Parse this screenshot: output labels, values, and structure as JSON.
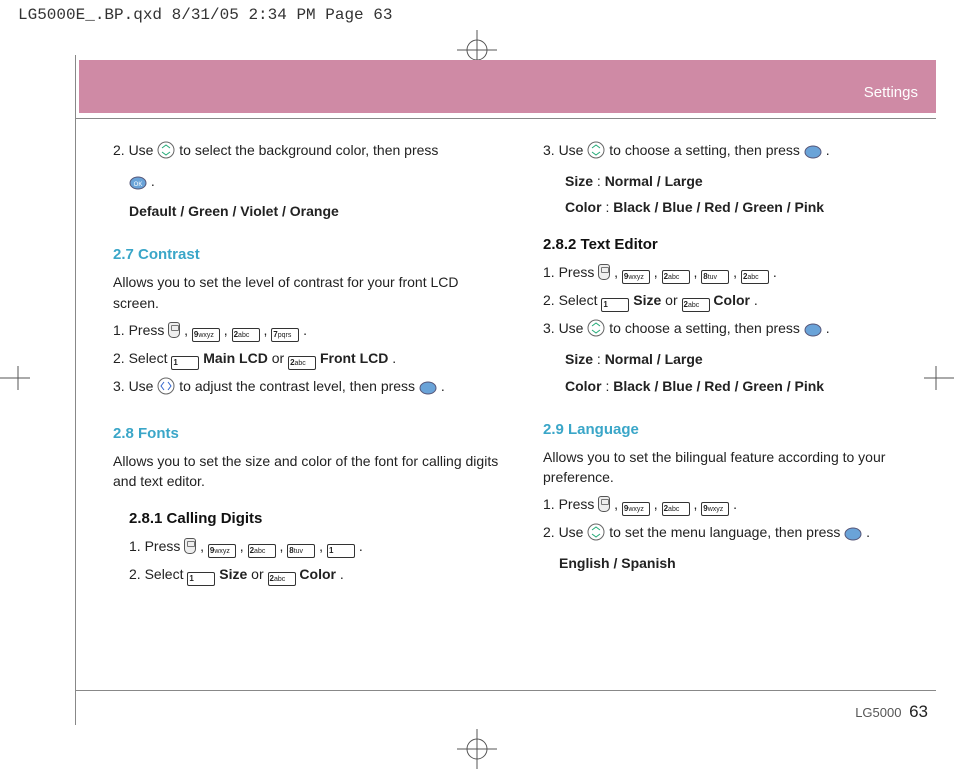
{
  "slug": "LG5000E_.BP.qxd  8/31/05  2:34 PM  Page 63",
  "tab": "Settings",
  "footer_model": "LG5000",
  "footer_page": "63",
  "left": {
    "s1_step2a": "2. Use ",
    "s1_step2b": " to select the background color, then press ",
    "s1_step2d": ".",
    "s1_opts": "Default / Green / Violet / Orange",
    "h27": "2.7 Contrast",
    "h27_desc": "Allows you to set the level of contrast for your front LCD screen.",
    "h27_s1a": "1. Press ",
    "comma": " , ",
    "period": " .",
    "h27_s2a": "2. Select  ",
    "h27_s2b": "Main LCD",
    "h27_s2c": " or  ",
    "h27_s2d": "Front LCD",
    "h27_s3a": "3. Use  ",
    "h27_s3b": " to adjust the contrast level, then press ",
    "h28": "2.8 Fonts",
    "h28_desc": "Allows you to set the size and color of the font for calling digits and text editor.",
    "h281": "2.8.1 Calling Digits",
    "h281_s1a": "1. Press ",
    "h281_s2a": "2. Select  ",
    "h281_s2b": "Size",
    "h281_s2c": " or  ",
    "h281_s2d": "Color"
  },
  "right": {
    "r1a": "3. Use ",
    "r1b": " to choose a setting, then press ",
    "size_line_a": "Size",
    "size_line_b": " : ",
    "size_line_c": "Normal / Large",
    "color_line_a": "Color",
    "color_line_b": " : ",
    "color_line_c": "Black / Blue / Red / Green / Pink",
    "h282": "2.8.2 Text Editor",
    "h282_s1": "1. Press ",
    "h282_s2a": "2. Select  ",
    "h282_s2b": "Size",
    "h282_s2c": " or  ",
    "h282_s2d": "Color",
    "h282_s3a": "3. Use ",
    "h282_s3b": " to choose a setting, then press ",
    "h29": "2.9 Language",
    "h29_desc": "Allows you to set the bilingual feature according to your preference.",
    "h29_s1": "1. Press ",
    "h29_s2a": "2. Use  ",
    "h29_s2b": " to set the menu language, then press ",
    "h29_opts": "English / Spanish"
  },
  "keys": {
    "k1": "1",
    "k2": "2 abc",
    "k7": "7 pqrs",
    "k8": "8 tuv",
    "k9": "9 wxyz"
  }
}
